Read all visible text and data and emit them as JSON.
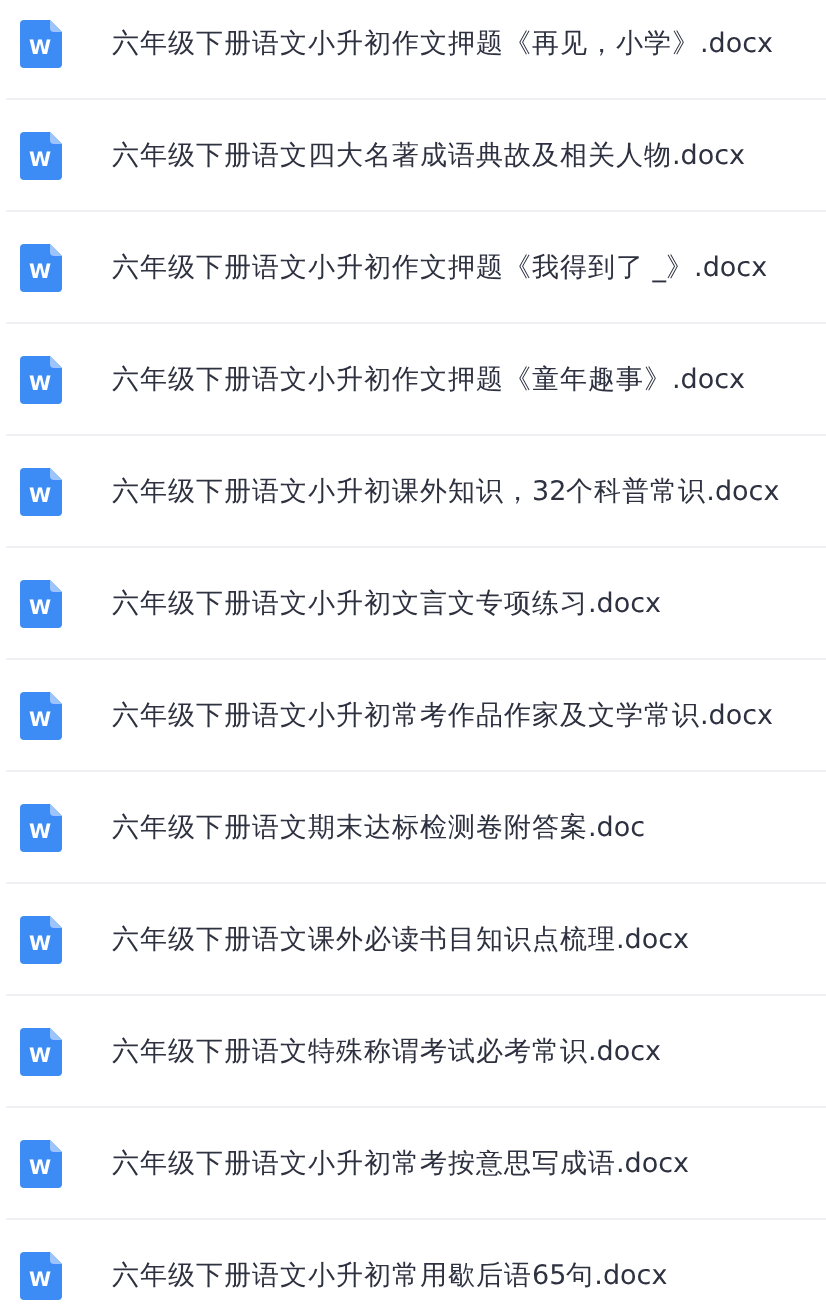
{
  "files": [
    {
      "icon_label": "W",
      "name": "六年级下册语文小升初作文押题《再见，小学》.docx"
    },
    {
      "icon_label": "W",
      "name": "六年级下册语文四大名著成语典故及相关人物.docx"
    },
    {
      "icon_label": "W",
      "name": "六年级下册语文小升初作文押题《我得到了 _》.docx"
    },
    {
      "icon_label": "W",
      "name": "六年级下册语文小升初作文押题《童年趣事》.docx"
    },
    {
      "icon_label": "W",
      "name": "六年级下册语文小升初课外知识，32个科普常识.docx"
    },
    {
      "icon_label": "W",
      "name": "六年级下册语文小升初文言文专项练习.docx"
    },
    {
      "icon_label": "W",
      "name": "六年级下册语文小升初常考作品作家及文学常识.docx"
    },
    {
      "icon_label": "W",
      "name": "六年级下册语文期末达标检测卷附答案.doc"
    },
    {
      "icon_label": "W",
      "name": "六年级下册语文课外必读书目知识点梳理.docx"
    },
    {
      "icon_label": "W",
      "name": "六年级下册语文特殊称谓考试必考常识.docx"
    },
    {
      "icon_label": "W",
      "name": "六年级下册语文小升初常考按意思写成语.docx"
    },
    {
      "icon_label": "W",
      "name": "六年级下册语文小升初常用歇后语65句.docx"
    }
  ]
}
